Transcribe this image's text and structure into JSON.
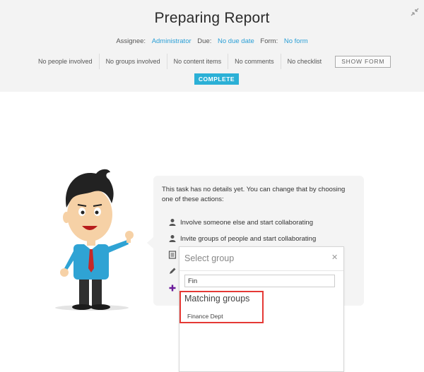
{
  "header": {
    "title": "Preparing Report",
    "collapse_icon": "collapse-arrows-icon",
    "meta": {
      "assignee_label": "Assignee:",
      "assignee_value": "Administrator",
      "due_label": "Due:",
      "due_value": "No due date",
      "form_label": "Form:",
      "form_value": "No form"
    },
    "stats": [
      "No people involved",
      "No groups involved",
      "No content items",
      "No comments",
      "No checklist"
    ],
    "show_form_label": "SHOW FORM",
    "complete_label": "COMPLETE"
  },
  "details": {
    "intro": "This task has no details yet. You can change that by choosing one of these actions:",
    "actions": [
      {
        "label": "Involve someone else and start collaborating",
        "icon": "person-icon"
      },
      {
        "label": "Invite groups of people and start collaborating",
        "icon": "person-icon"
      },
      {
        "label": "",
        "icon": "document-icon"
      },
      {
        "label": "",
        "icon": "pencil-icon"
      },
      {
        "label": "",
        "icon": "plus-icon"
      }
    ]
  },
  "group_popup": {
    "title": "Select group",
    "close_icon": "close-icon",
    "search_value": "Fin",
    "matching_heading": "Matching groups",
    "matches": [
      "Finance Dept"
    ]
  },
  "colors": {
    "accent": "#2a9fd6",
    "complete_button": "#2bb0d6",
    "highlight_border": "#e53935",
    "header_bg": "#f3f3f3"
  }
}
